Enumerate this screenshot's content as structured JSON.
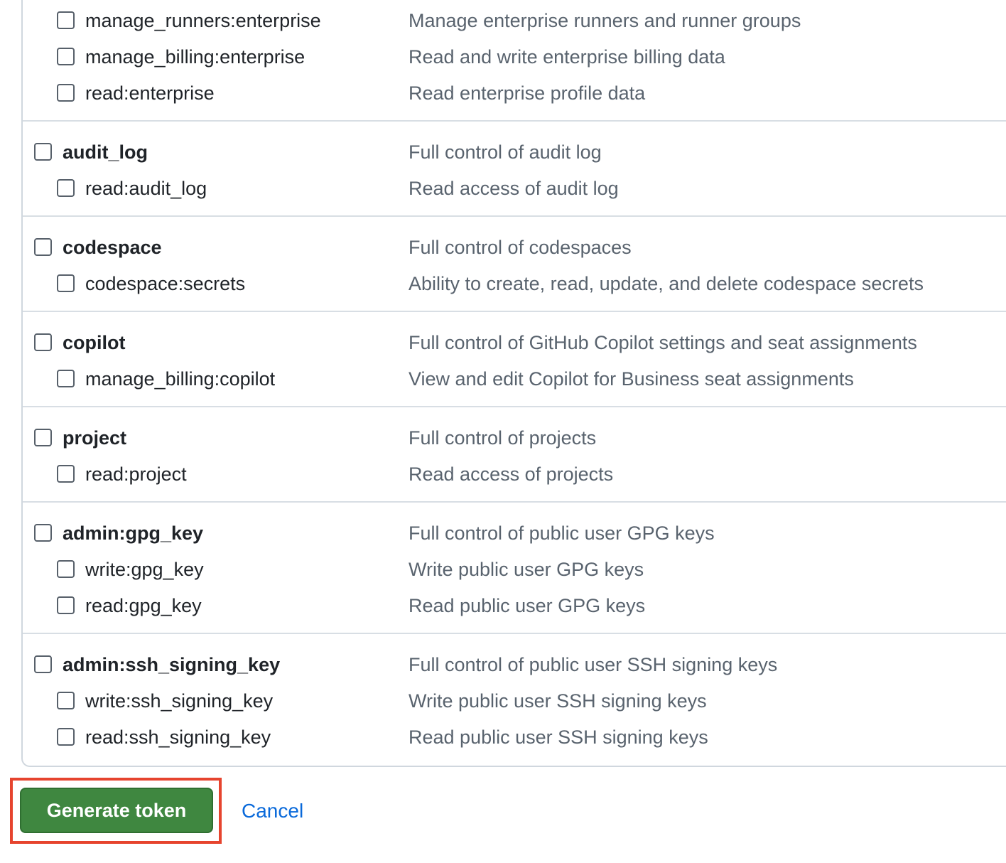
{
  "scopes": [
    {
      "name": "manage_runners:enterprise",
      "description": "Manage enterprise runners and runner groups",
      "level": "child"
    },
    {
      "name": "manage_billing:enterprise",
      "description": "Read and write enterprise billing data",
      "level": "child"
    },
    {
      "name": "read:enterprise",
      "description": "Read enterprise profile data",
      "level": "child"
    },
    {
      "name": "audit_log",
      "description": "Full control of audit log",
      "level": "parent"
    },
    {
      "name": "read:audit_log",
      "description": "Read access of audit log",
      "level": "child"
    },
    {
      "name": "codespace",
      "description": "Full control of codespaces",
      "level": "parent"
    },
    {
      "name": "codespace:secrets",
      "description": "Ability to create, read, update, and delete codespace secrets",
      "level": "child"
    },
    {
      "name": "copilot",
      "description": "Full control of GitHub Copilot settings and seat assignments",
      "level": "parent"
    },
    {
      "name": "manage_billing:copilot",
      "description": "View and edit Copilot for Business seat assignments",
      "level": "child"
    },
    {
      "name": "project",
      "description": "Full control of projects",
      "level": "parent"
    },
    {
      "name": "read:project",
      "description": "Read access of projects",
      "level": "child"
    },
    {
      "name": "admin:gpg_key",
      "description": "Full control of public user GPG keys",
      "level": "parent"
    },
    {
      "name": "write:gpg_key",
      "description": "Write public user GPG keys",
      "level": "child"
    },
    {
      "name": "read:gpg_key",
      "description": "Read public user GPG keys",
      "level": "child"
    },
    {
      "name": "admin:ssh_signing_key",
      "description": "Full control of public user SSH signing keys",
      "level": "parent"
    },
    {
      "name": "write:ssh_signing_key",
      "description": "Write public user SSH signing keys",
      "level": "child"
    },
    {
      "name": "read:ssh_signing_key",
      "description": "Read public user SSH signing keys",
      "level": "child"
    }
  ],
  "actions": {
    "generate_label": "Generate token",
    "cancel_label": "Cancel"
  },
  "colors": {
    "primary_button": "#3f8740",
    "link": "#0969da",
    "highlight": "#e6442e"
  }
}
